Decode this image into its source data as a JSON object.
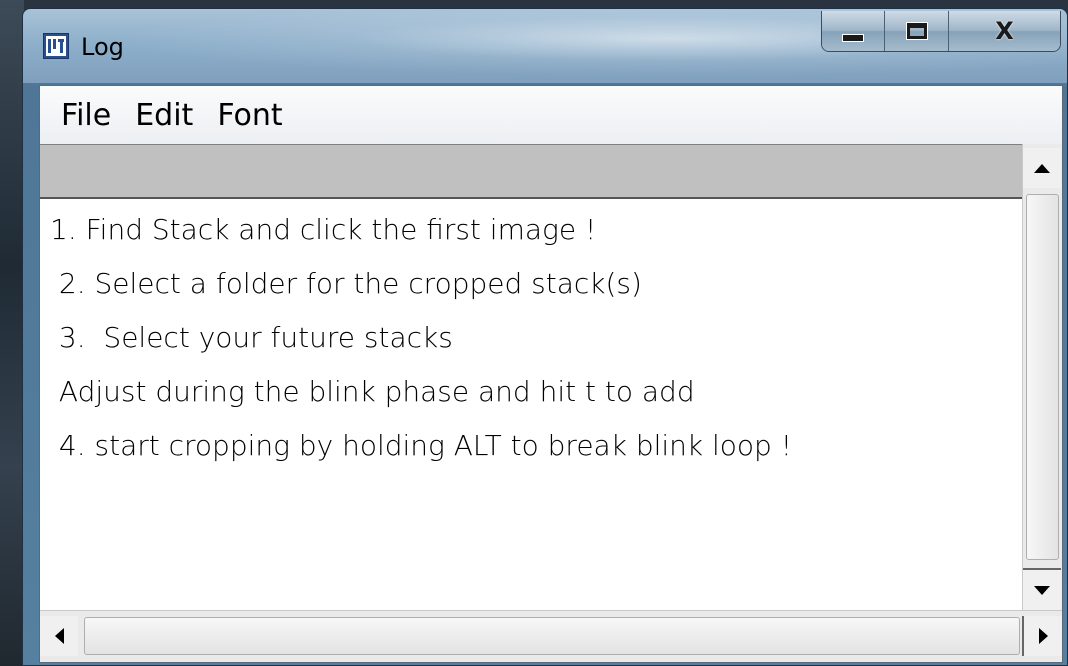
{
  "window": {
    "title": "Log",
    "icon": "imagej-log-icon"
  },
  "caption": {
    "minimize_icon": "minimize-icon",
    "maximize_icon": "maximize-icon",
    "close_label": "X"
  },
  "menubar": {
    "items": [
      {
        "label": "File"
      },
      {
        "label": "Edit"
      },
      {
        "label": "Font"
      }
    ]
  },
  "log": {
    "lines": [
      "1. Find Stack and click the first image !",
      " 2. Select a folder for the cropped stack(s)",
      " 3.  Select your future stacks",
      " Adjust during the blink phase and hit t to add",
      " 4. start cropping by holding ALT to break blink loop !"
    ]
  },
  "colors": {
    "header_strip": "#c0c0c0",
    "text_bg": "#ffffff",
    "title_bar": "#8fb0cb"
  }
}
